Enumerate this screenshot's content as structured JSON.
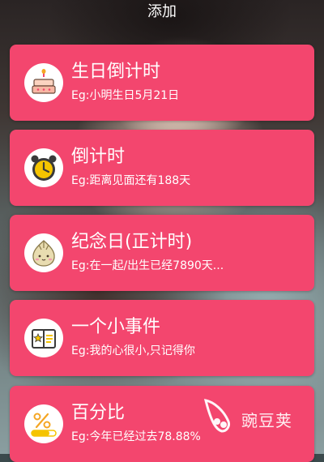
{
  "header": {
    "title": "添加"
  },
  "cards": [
    {
      "title": "生日倒计时",
      "subtitle": "Eg:小明生日5月21日",
      "icon": "birthday-cake-icon"
    },
    {
      "title": "倒计时",
      "subtitle": "Eg:距离见面还有188天",
      "icon": "alarm-clock-icon"
    },
    {
      "title": "纪念日(正计时)",
      "subtitle": "Eg:在一起/出生已经7890天...",
      "icon": "anniversary-bun-icon"
    },
    {
      "title": "一个小事件",
      "subtitle": "Eg:我的心很小,只记得你",
      "icon": "note-star-icon"
    },
    {
      "title": "百分比",
      "subtitle": "Eg:今年已经过去78.88%",
      "icon": "percent-icon"
    }
  ],
  "watermark": {
    "text": "豌豆荚"
  },
  "colors": {
    "card": "#f3466e",
    "text": "#ffffff",
    "accent_yellow": "#f5c400"
  }
}
